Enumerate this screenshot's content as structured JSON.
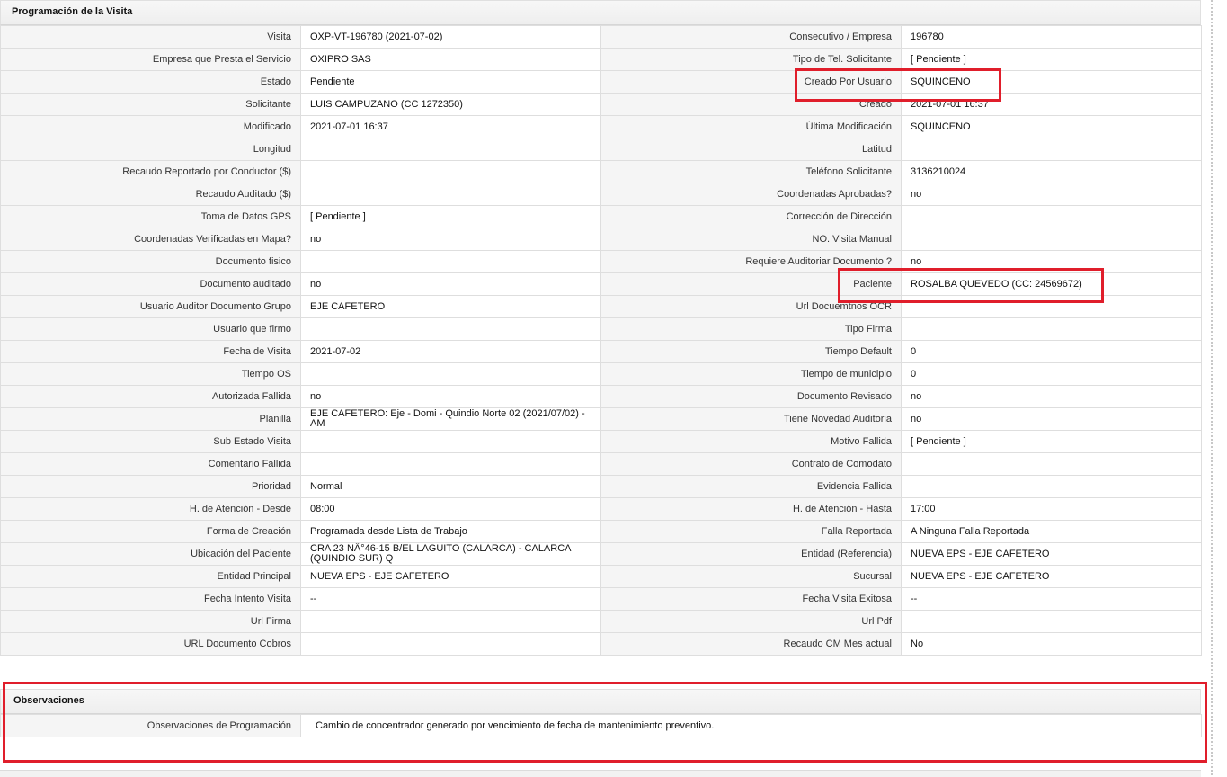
{
  "visita": {
    "title": "Programación de la Visita",
    "rows": [
      {
        "l1": "Visita",
        "v1": "OXP-VT-196780 (2021-07-02)",
        "l2": "Consecutivo / Empresa",
        "v2": "196780"
      },
      {
        "l1": "Empresa que Presta el Servicio",
        "v1": "OXIPRO SAS",
        "l2": "Tipo de Tel. Solicitante",
        "v2": "[ Pendiente ]"
      },
      {
        "l1": "Estado",
        "v1": "Pendiente",
        "l2": "Creado Por Usuario",
        "v2": "SQUINCENO"
      },
      {
        "l1": "Solicitante",
        "v1": "LUIS CAMPUZANO (CC 1272350)",
        "l2": "Creado",
        "v2": "2021-07-01 16:37"
      },
      {
        "l1": "Modificado",
        "v1": "2021-07-01 16:37",
        "l2": "Última Modificación",
        "v2": " SQUINCENO"
      },
      {
        "l1": "Longitud",
        "v1": "",
        "l2": "Latitud",
        "v2": ""
      },
      {
        "l1": "Recaudo Reportado por Conductor ($)",
        "v1": "",
        "l2": "Teléfono Solicitante",
        "v2": "3136210024"
      },
      {
        "l1": "Recaudo Auditado ($)",
        "v1": "",
        "l2": "Coordenadas Aprobadas?",
        "v2": " no"
      },
      {
        "l1": "Toma de Datos GPS",
        "v1": "[ Pendiente ]",
        "l2": "Corrección de Dirección",
        "v2": ""
      },
      {
        "l1": "Coordenadas Verificadas en Mapa?",
        "v1": " no",
        "l2": "NO. Visita Manual",
        "v2": ""
      },
      {
        "l1": "Documento fisico",
        "v1": "",
        "l2": "Requiere Auditoriar Documento ?",
        "v2": " no"
      },
      {
        "l1": "Documento auditado",
        "v1": " no",
        "l2": "Paciente",
        "v2": "ROSALBA QUEVEDO (CC: 24569672)"
      },
      {
        "l1": "Usuario Auditor Documento Grupo",
        "v1": "EJE CAFETERO",
        "l2": "Url Docuemtnos OCR",
        "v2": ""
      },
      {
        "l1": "Usuario que firmo",
        "v1": "",
        "l2": "Tipo Firma",
        "v2": ""
      },
      {
        "l1": "Fecha de Visita",
        "v1": " 2021-07-02",
        "l2": "Tiempo Default",
        "v2": "0"
      },
      {
        "l1": "Tiempo OS",
        "v1": "",
        "l2": "Tiempo de municipio",
        "v2": "0"
      },
      {
        "l1": "Autorizada Fallida",
        "v1": " no",
        "l2": "Documento Revisado",
        "v2": " no"
      },
      {
        "l1": "Planilla",
        "v1": "EJE CAFETERO: Eje - Domi - Quindio Norte 02 (2021/07/02) - AM",
        "l2": "Tiene Novedad Auditoria",
        "v2": " no"
      },
      {
        "l1": "Sub Estado Visita",
        "v1": "",
        "l2": "Motivo Fallida",
        "v2": "[ Pendiente ]"
      },
      {
        "l1": "Comentario Fallida",
        "v1": "",
        "l2": "Contrato de Comodato",
        "v2": ""
      },
      {
        "l1": "Prioridad",
        "v1": "Normal",
        "l2": "Evidencia Fallida",
        "v2": ""
      },
      {
        "l1": "H. de Atención - Desde",
        "v1": "08:00",
        "l2": "H. de Atención - Hasta",
        "v2": "17:00"
      },
      {
        "l1": "Forma de Creación",
        "v1": "Programada desde Lista de Trabajo",
        "l2": "Falla Reportada",
        "v2": "A Ninguna Falla Reportada"
      },
      {
        "l1": "Ubicación del Paciente",
        "v1": "CRA 23 NÂ°46-15 B/EL LAGUITO (CALARCA) - CALARCA (QUINDIO SUR) Q",
        "l2": "Entidad (Referencia)",
        "v2": "NUEVA EPS - EJE CAFETERO"
      },
      {
        "l1": "Entidad Principal",
        "v1": "NUEVA EPS - EJE CAFETERO",
        "l2": "Sucursal",
        "v2": "NUEVA EPS - EJE CAFETERO"
      },
      {
        "l1": "Fecha Intento Visita",
        "v1": " --",
        "l2": "Fecha Visita Exitosa",
        "v2": " --"
      },
      {
        "l1": "Url Firma",
        "v1": "",
        "l2": "Url Pdf",
        "v2": ""
      },
      {
        "l1": "URL Documento Cobros",
        "v1": "",
        "l2": "Recaudo CM Mes actual",
        "v2": "No"
      }
    ]
  },
  "observaciones": {
    "title": "Observaciones",
    "label": "Observaciones de Programación",
    "value": " Cambio de concentrador generado por vencimiento de fecha de mantenimiento preventivo."
  },
  "colors": {
    "highlight": "#e01e2b",
    "label_bg": "#f5f5f5",
    "border": "#dedede"
  }
}
